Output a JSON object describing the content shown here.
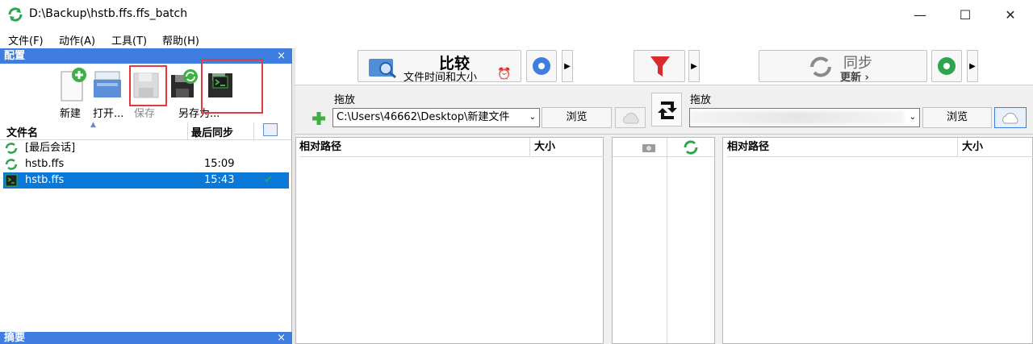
{
  "window": {
    "title": "D:\\Backup\\hstb.ffs.ffs_batch",
    "controls": {
      "minimize": "—",
      "maximize": "☐",
      "close": "✕"
    }
  },
  "menu": [
    "文件(F)",
    "动作(A)",
    "工具(T)",
    "帮助(H)"
  ],
  "config_panel": {
    "title": "配置",
    "close": "×",
    "toolbar": {
      "new": "新建",
      "open": "打开...",
      "save": "保存",
      "save_as": "另存为..."
    },
    "columns": {
      "name": "文件名",
      "last_sync": "最后同步"
    },
    "rows": [
      {
        "name": "[最后会话]",
        "time": "",
        "check": ""
      },
      {
        "name": "hstb.ffs",
        "time": "15:09",
        "check": ""
      },
      {
        "name": "hstb.ffs",
        "time": "15:43",
        "check": "✔"
      }
    ]
  },
  "summary_panel": {
    "title": "摘要",
    "close": "×"
  },
  "main_toolbar": {
    "compare_title": "比较",
    "compare_sub": "文件时间和大小",
    "sync_title": "同步",
    "sync_sub": "更新 ›"
  },
  "left_folder": {
    "drop_label": "拖放",
    "path": "C:\\Users\\46662\\Desktop\\新建文件",
    "browse": "浏览"
  },
  "right_folder": {
    "drop_label": "拖放",
    "path": "",
    "browse": "浏览"
  },
  "file_view": {
    "rel_path": "相对路径",
    "size": "大小"
  },
  "colors": {
    "accent": "#3f7de0",
    "selection": "#0a78d7",
    "highlight": "#e33b3b",
    "green": "#2ea44f"
  }
}
